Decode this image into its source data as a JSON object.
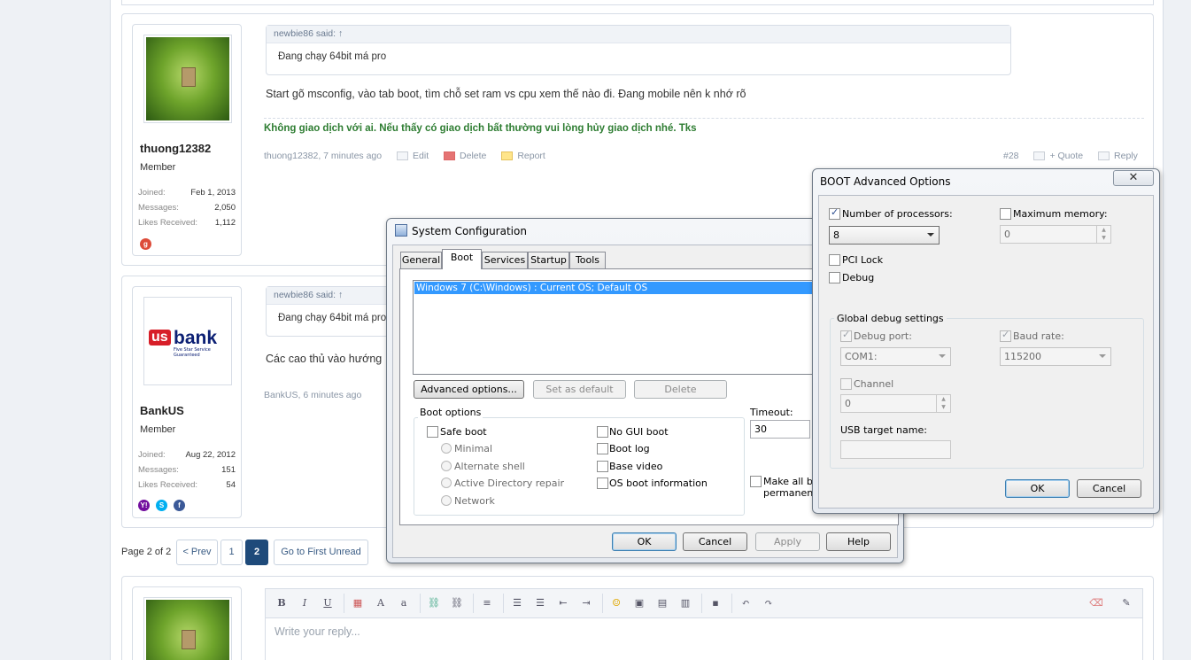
{
  "post1": {
    "username": "thuong12382",
    "user_title": "Member",
    "stats": [
      {
        "label": "Joined:",
        "value": "Feb 1, 2013"
      },
      {
        "label": "Messages:",
        "value": "2,050"
      },
      {
        "label": "Likes Received:",
        "value": "1,112"
      }
    ],
    "quote_author": "newbie86 said: ↑",
    "quote_text": "Đang chạy 64bit má pro",
    "message": "Start gõ msconfig, vào tab boot, tìm chỗ set ram vs cpu xem thế nào đi. Đang mobile nên k nhớ rõ",
    "signature": "Không giao dịch với ai. Nếu thấy có giao dịch bất thường vui lòng hủy giao dịch nhé. Tks",
    "meta_author_time": "thuong12382, 7 minutes ago",
    "edit": "Edit",
    "delete": "Delete",
    "report": "Report",
    "post_number": "#28",
    "quote_btn": "+ Quote",
    "reply_btn": "Reply"
  },
  "post2": {
    "username": "BankUS",
    "user_title": "Member",
    "logo_us": "us",
    "logo_bank": "bank",
    "logo_tag": "Five Star Service Guaranteed",
    "stats": [
      {
        "label": "Joined:",
        "value": "Aug 22, 2012"
      },
      {
        "label": "Messages:",
        "value": "151"
      },
      {
        "label": "Likes Received:",
        "value": "54"
      }
    ],
    "quote_author": "newbie86 said: ↑",
    "quote_text": "Đang chạy 64bit má pro",
    "message": "Các cao thủ vào hướng",
    "meta_author_time": "BankUS, 6 minutes ago"
  },
  "pagination": {
    "label": "Page 2 of 2",
    "prev": "< Prev",
    "page1": "1",
    "page2": "2",
    "first_unread": "Go to First Unread"
  },
  "editor": {
    "placeholder": "Write your reply..."
  },
  "sysconfig": {
    "title": "System Configuration",
    "tabs": [
      "General",
      "Boot",
      "Services",
      "Startup",
      "Tools"
    ],
    "os_entry": "Windows 7 (C:\\Windows) : Current OS; Default OS",
    "advanced_btn": "Advanced options...",
    "set_default_btn": "Set as default",
    "delete_btn": "Delete",
    "boot_options_label": "Boot options",
    "safe_boot": "Safe boot",
    "minimal": "Minimal",
    "alternate_shell": "Alternate shell",
    "ad_repair": "Active Directory repair",
    "network": "Network",
    "no_gui": "No GUI boot",
    "boot_log": "Boot log",
    "base_video": "Base video",
    "os_boot_info": "OS boot information",
    "timeout_label": "Timeout:",
    "timeout_value": "30",
    "make_permanent_1": "Make all boo",
    "make_permanent_2": "permanent",
    "ok": "OK",
    "cancel": "Cancel",
    "apply": "Apply",
    "help": "Help"
  },
  "advanced": {
    "title": "BOOT Advanced Options",
    "close_icon": "close-icon",
    "num_processors": "Number of processors:",
    "num_processors_value": "8",
    "max_memory": "Maximum memory:",
    "max_memory_value": "0",
    "pci_lock": "PCI Lock",
    "debug": "Debug",
    "global_debug": "Global debug settings",
    "debug_port": "Debug port:",
    "debug_port_value": "COM1:",
    "baud_rate": "Baud rate:",
    "baud_rate_value": "115200",
    "channel": "Channel",
    "channel_value": "0",
    "usb_target": "USB target name:",
    "ok": "OK",
    "cancel": "Cancel"
  },
  "colors": {
    "signature_green": "#2e7d32",
    "page_current": "#1e4a7a",
    "link_blue": "#3b5d85",
    "selection_blue": "#3399ff"
  }
}
